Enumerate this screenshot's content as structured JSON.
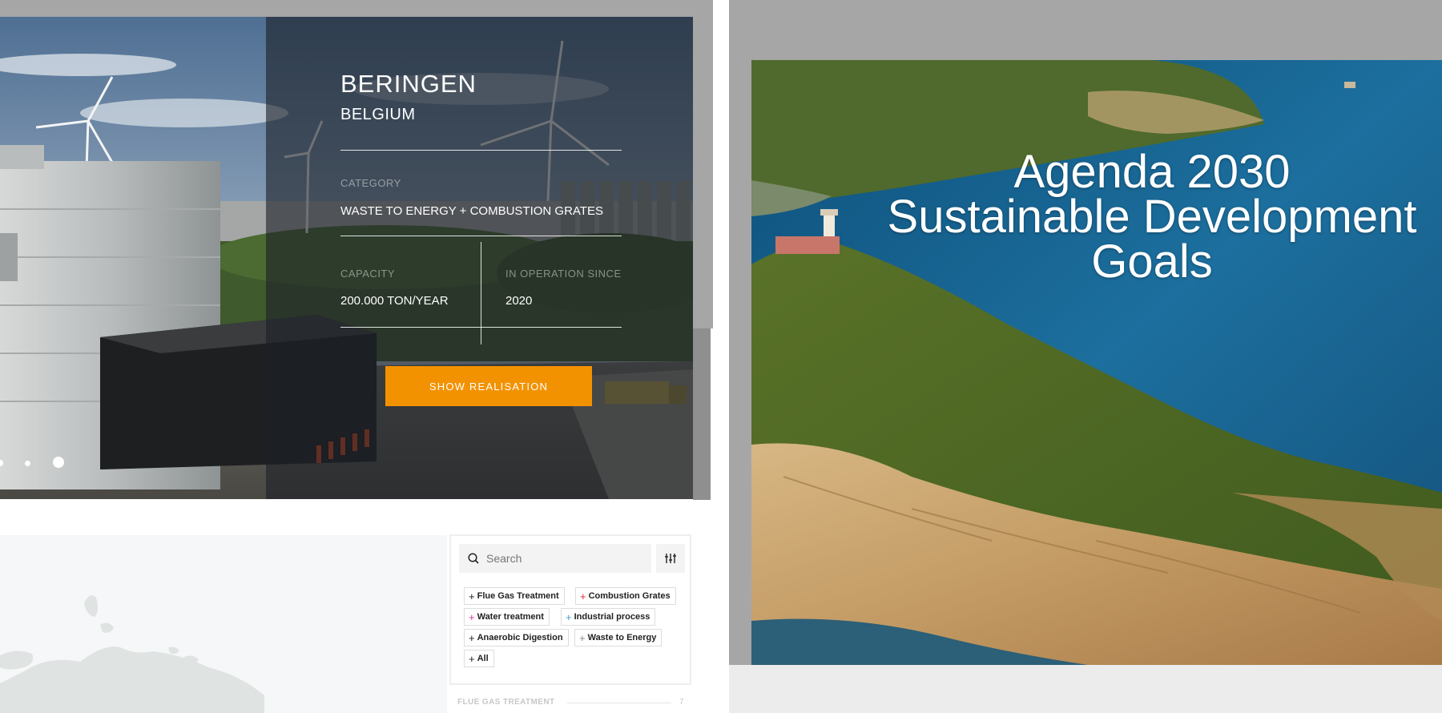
{
  "left_screen": {
    "project": {
      "city": "BERINGEN",
      "country": "BELGIUM",
      "category_label": "CATEGORY",
      "category_value": "WASTE TO ENERGY + COMBUSTION GRATES",
      "capacity_label": "CAPACITY",
      "capacity_value": "200.000 TON/YEAR",
      "operation_label": "IN OPERATION SINCE",
      "operation_value": "2020",
      "cta_label": "SHOW REALISATION"
    },
    "carousel": {
      "slide_count": 3,
      "active_index": 2
    },
    "filter": {
      "search_placeholder": "Search",
      "tags": [
        {
          "label": "Flue Gas Treatment",
          "plus_color": "#222222"
        },
        {
          "label": "Combustion Grates",
          "plus_color": "#e3262b"
        },
        {
          "label": "Water treatment",
          "plus_color": "#d83a8c"
        },
        {
          "label": "Industrial process",
          "plus_color": "#3aa0d8"
        },
        {
          "label": "Anaerobic Digestion",
          "plus_color": "#222222"
        },
        {
          "label": "Waste to Energy",
          "plus_color": "#888888"
        },
        {
          "label": "All",
          "plus_color": "#222222"
        }
      ],
      "list_heading": "FLUE GAS TREATMENT",
      "list_count": "7"
    },
    "colors": {
      "accent": "#f39200"
    }
  },
  "right_screen": {
    "slide_title_line1": "Agenda 2030",
    "slide_title_line2": "Sustainable Development",
    "slide_title_line3": "Goals"
  }
}
